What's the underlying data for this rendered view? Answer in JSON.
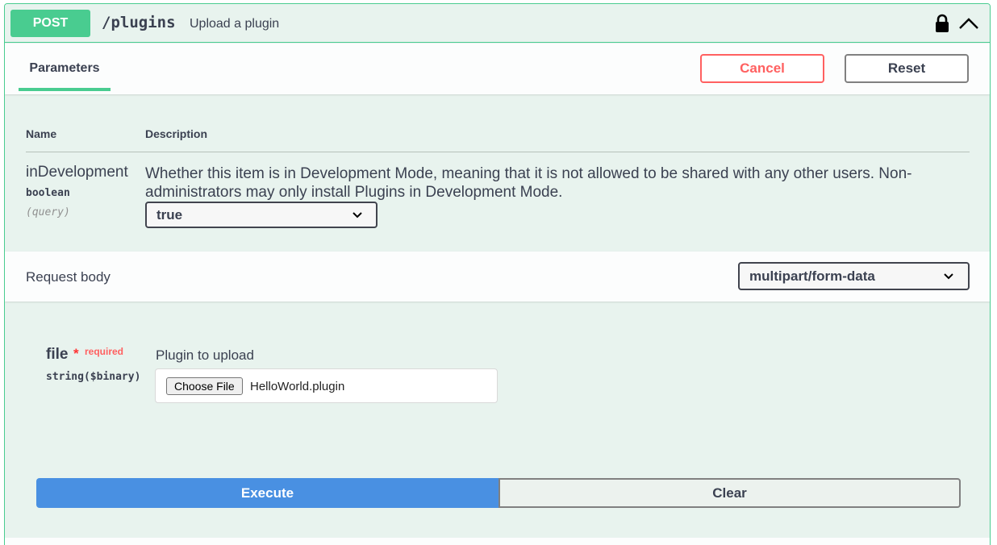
{
  "operation": {
    "method": "POST",
    "path": "/plugins",
    "summary": "Upload a plugin"
  },
  "colors": {
    "accent": "#49cc90",
    "execute": "#4990e2",
    "cancel": "#ff6060",
    "required": "#ff3333"
  },
  "tabs": {
    "parameters": "Parameters"
  },
  "buttons": {
    "cancel": "Cancel",
    "reset": "Reset",
    "execute": "Execute",
    "clear": "Clear"
  },
  "params_table": {
    "headers": {
      "name": "Name",
      "description": "Description"
    },
    "rows": [
      {
        "name": "inDevelopment",
        "type": "boolean",
        "in": "(query)",
        "description": "Whether this item is in Development Mode, meaning that it is not allowed to be shared with any other users. Non-administrators may only install Plugins in Development Mode.",
        "selected": "true"
      }
    ]
  },
  "request_body": {
    "title": "Request body",
    "content_type": "multipart/form-data",
    "field": {
      "name": "file",
      "required_star": "*",
      "required_label": "required",
      "type": "string($binary)",
      "description": "Plugin to upload",
      "choose_label": "Choose File",
      "chosen": "HelloWorld.plugin"
    }
  },
  "icons": [
    "lock-icon",
    "chevron-up-icon",
    "chevron-down-icon"
  ]
}
